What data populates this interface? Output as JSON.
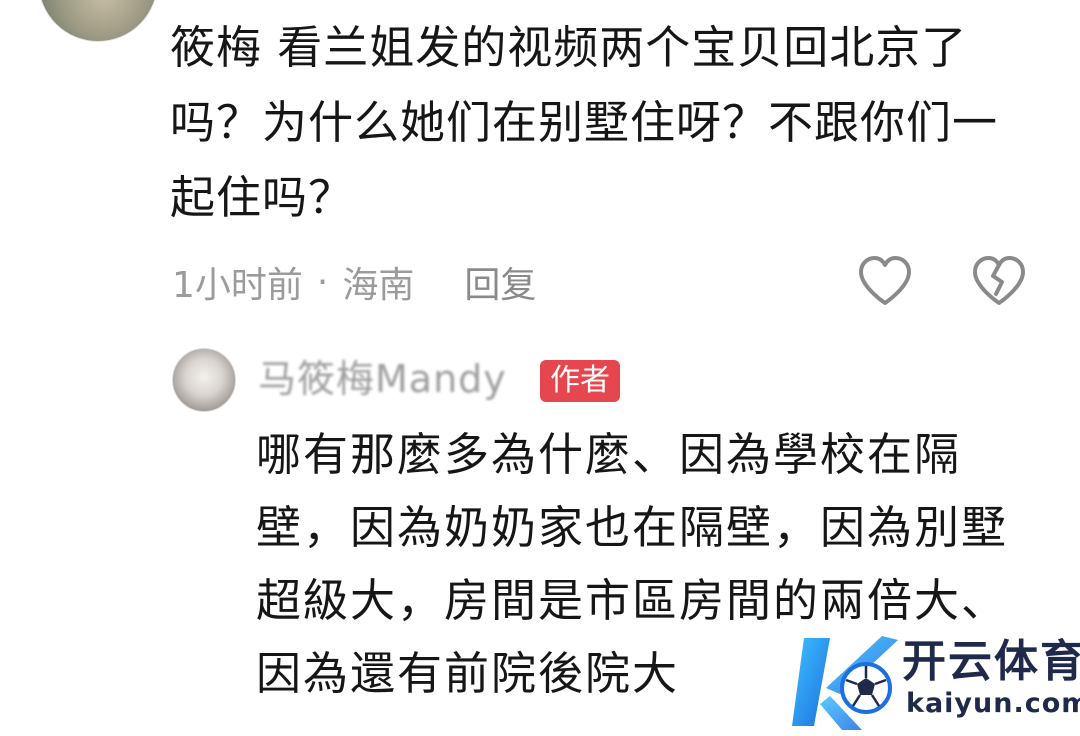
{
  "comment": {
    "text": "筱梅 看兰姐发的视频两个宝贝回北京了吗？为什么她们在别墅住呀？不跟你们一起住吗？",
    "time": "1小时前",
    "separator": "·",
    "location": "海南",
    "reply_label": "回复",
    "like_icon": "heart-outline",
    "dislike_icon": "broken-heart-outline"
  },
  "reply": {
    "author_name": "马筱梅Mandy",
    "author_badge": "作者",
    "badge_color": "#e6474f",
    "text": "哪有那麼多為什麼、因為學校在隔壁，因為奶奶家也在隔壁，因為別墅超級大，房間是市區房間的兩倍大、因為還有前院後院大"
  },
  "watermark": {
    "brand": "开云体育",
    "domain": "kaiyun.com",
    "logo_icon": "k-soccer-ball-logo"
  }
}
